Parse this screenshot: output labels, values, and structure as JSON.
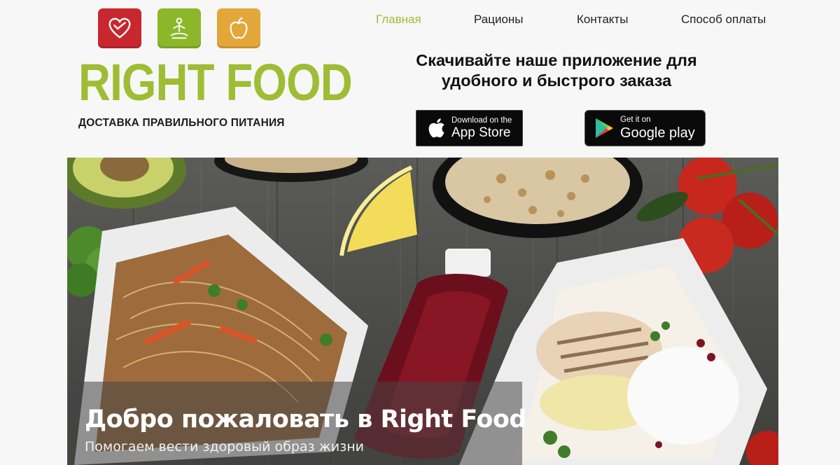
{
  "brand": {
    "name": "RIGHT FOOD",
    "tagline": "ДОСТАВКА ПРАВИЛЬНОГО ПИТАНИЯ",
    "accent_color": "#9ebd34",
    "icons": [
      {
        "name": "heart-icon",
        "color": "#c9272f"
      },
      {
        "name": "meditation-icon",
        "color": "#8cb72a"
      },
      {
        "name": "apple-icon",
        "color": "#e3a638"
      }
    ]
  },
  "nav": {
    "items": [
      {
        "label": "Главная",
        "active": true
      },
      {
        "label": "Рационы",
        "active": false
      },
      {
        "label": "Контакты",
        "active": false
      },
      {
        "label": "Способ оплаты",
        "active": false
      }
    ]
  },
  "promo": {
    "line1": "Скачивайте наше приложение для",
    "line2": "удобного и быстрого заказа"
  },
  "stores": {
    "apple": {
      "small": "Download on the",
      "big": "App Store"
    },
    "google": {
      "small": "Get it on",
      "big": "Google play"
    }
  },
  "hero": {
    "title": "Добро пожаловать в Right Food",
    "subtitle": "Помогаем вести здоровый образ жизни"
  }
}
